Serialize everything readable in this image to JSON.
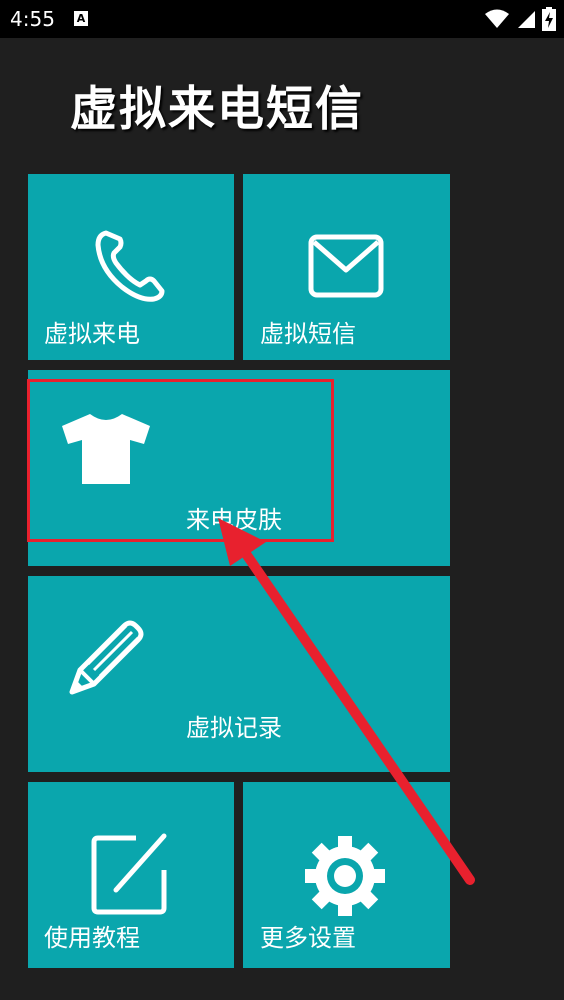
{
  "status_bar": {
    "time": "4:55",
    "icons": [
      "notification-a-icon",
      "wifi-icon",
      "signal-icon",
      "battery-charging-icon"
    ]
  },
  "app": {
    "title": "虚拟来电短信"
  },
  "tiles": {
    "call": {
      "label": "虚拟来电",
      "icon": "phone-icon"
    },
    "sms": {
      "label": "虚拟短信",
      "icon": "envelope-icon"
    },
    "skin": {
      "label": "来电皮肤",
      "icon": "tshirt-icon"
    },
    "records": {
      "label": "虚拟记录",
      "icon": "pencil-icon"
    },
    "tutorial": {
      "label": "使用教程",
      "icon": "edit-icon"
    },
    "settings": {
      "label": "更多设置",
      "icon": "gear-icon"
    }
  },
  "annotation": {
    "highlight_color": "#e8212e",
    "tile_color": "#0aa6ad"
  }
}
